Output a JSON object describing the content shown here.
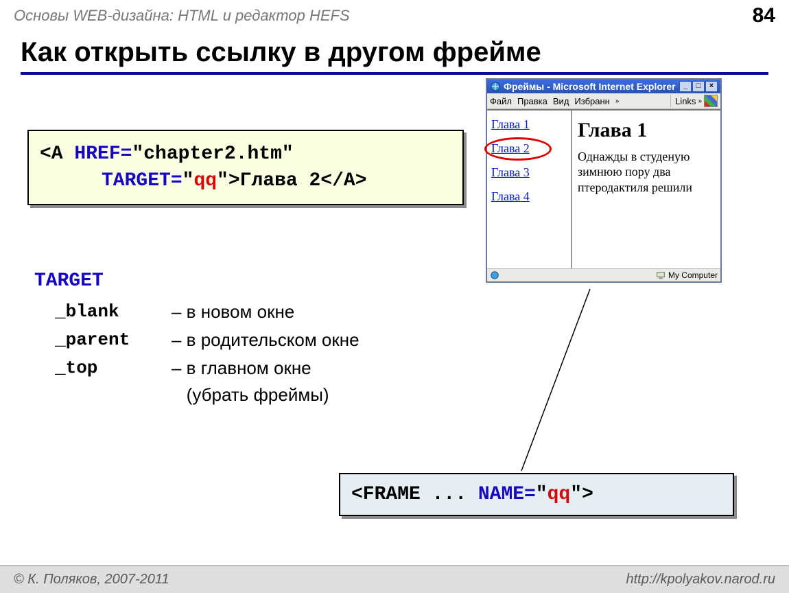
{
  "header": {
    "subject": "Основы WEB-дизайна: HTML и редактор HEFS",
    "page": "84"
  },
  "title": "Как открыть ссылку в другом фрейме",
  "code": {
    "open_tag": "<A ",
    "href_attr": "HREF=",
    "href_val": "\"chapter2.htm\"",
    "target_attr": "TARGET=",
    "target_val": "\"qq\"",
    "after_gt": ">Глава 2",
    "close_tag": "</A>"
  },
  "target": {
    "header": "TARGET",
    "items": [
      {
        "key": "_blank",
        "sep": "–",
        "desc": "в новом окне"
      },
      {
        "key": "_parent",
        "sep": "–",
        "desc": "в родительском окне"
      },
      {
        "key": "_top",
        "sep": "–",
        "desc": "в главном окне (убрать фреймы)"
      }
    ]
  },
  "frame_code": {
    "open": "<FRAME ... ",
    "name_attr": "NAME=",
    "name_val": "\"qq\"",
    "close": ">"
  },
  "browser": {
    "title": "Фреймы - Microsoft Internet Explorer",
    "menu": [
      "Файл",
      "Правка",
      "Вид",
      "Избранн"
    ],
    "links_label": "Links",
    "left_links": [
      "Глава 1",
      "Глава 2",
      "Глава 3",
      "Глава 4"
    ],
    "circled_index": 1,
    "right": {
      "heading": "Глава 1",
      "text": "Однажды в студеную зимнюю пору два птеродактиля решили"
    },
    "status_right": "My Computer"
  },
  "footer": {
    "left": "© К. Поляков, 2007-2011",
    "right": "http://kpolyakov.narod.ru"
  }
}
